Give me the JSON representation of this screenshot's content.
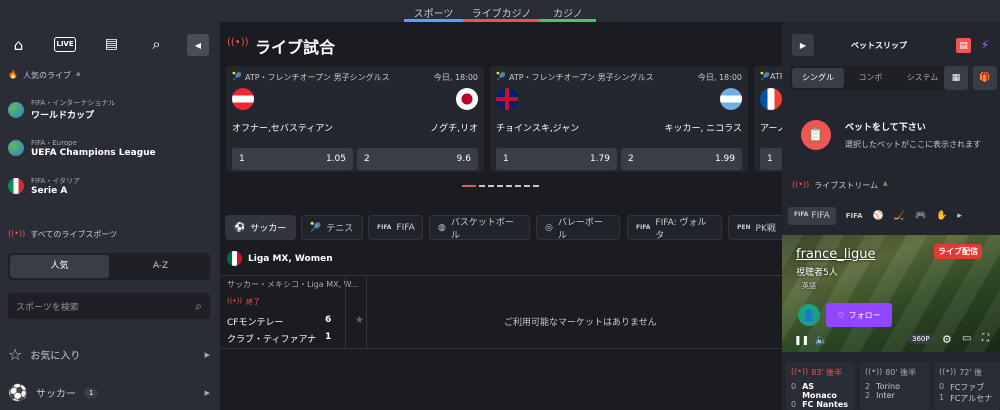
{
  "topnav": [
    "スポーツ",
    "ライブカジノ",
    "カジノ"
  ],
  "left": {
    "live_button": "LIVE",
    "popular_live": "人気のライブ",
    "items": [
      {
        "sub": "FIFA・インターナショナル",
        "title": "ワールドカップ"
      },
      {
        "sub": "FIFA・Europe",
        "title": "UEFA Champions League"
      },
      {
        "sub": "FIFA・イタリア",
        "title": "Serie A"
      }
    ],
    "all_live": "すべてのライブスポーツ",
    "tabs": [
      "人気",
      "A-Z"
    ],
    "search_placeholder": "スポーツを検索",
    "favorites": "お気に入り",
    "soccer": "サッカー",
    "soccer_count": "1"
  },
  "main": {
    "title": "ライブ試合",
    "cards": [
      {
        "league": "ATP・フレンチオープン 男子シングルス",
        "time": "今日, 18:00",
        "p1": "オフナー,セバスティアン",
        "p2": "ノグチ,リオ",
        "o1": "1",
        "v1": "1.05",
        "o2": "2",
        "v2": "9.6"
      },
      {
        "league": "ATP・フレンチオープン 男子シングルス",
        "time": "今日, 18:00",
        "p1": "チョインスキ,ジャン",
        "p2": "キッカー, ニコラス",
        "o1": "1",
        "v1": "1.79",
        "o2": "2",
        "v2": "1.99"
      },
      {
        "league": "ATP",
        "time": "",
        "p1": "アーノ",
        "p2": "",
        "o1": "1",
        "v1": "",
        "o2": "",
        "v2": ""
      }
    ],
    "sports": [
      "サッカー",
      "テニス",
      "FIFA",
      "バスケットボール",
      "バレーボール",
      "FIFA: ヴォルタ",
      "PK戦"
    ],
    "league": "Liga MX, Women",
    "breadcrumb": "サッカー・メキシコ・Liga MX, W...",
    "status": "終了",
    "team1": "CFモンテレー",
    "score1": "6",
    "team2": "クラブ・ティファアナ・デ",
    "score2": "1",
    "no_market": "ご利用可能なマーケットはありません"
  },
  "right": {
    "betslip": "ベットスリップ",
    "tabs": [
      "シングル",
      "コンボ",
      "システム"
    ],
    "empty_title": "ベットをして下さい",
    "empty_desc": "選択したベットがここに表示されます",
    "livestream": "ライブストリーム",
    "stream_tab": "FIFA",
    "channel": "france_ligue",
    "viewers": "視聴者5人",
    "language": "英語",
    "live_label": "ライブ配信",
    "follow": "フォロー",
    "quality": "360P",
    "matches": [
      {
        "minute": "83' 後半",
        "t1": "AS Monaco",
        "t2": "FC Nantes",
        "s1": "0",
        "s2": "0"
      },
      {
        "minute": "80' 後半",
        "t1": "Torino",
        "t2": "Inter",
        "s1": "2",
        "s2": "2"
      },
      {
        "minute": "72' 後",
        "t1": "FCファブ",
        "t2": "FCアルセナ",
        "s1": "0",
        "s2": "1"
      }
    ]
  }
}
